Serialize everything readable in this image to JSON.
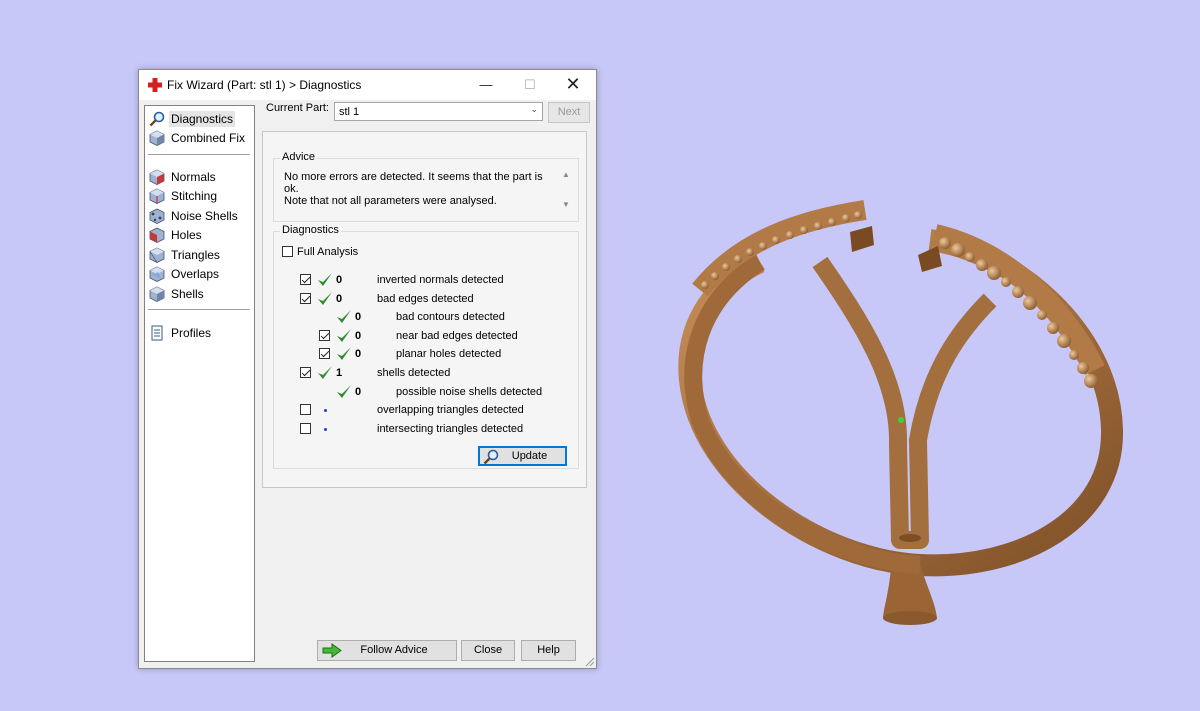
{
  "window": {
    "title": "Fix Wizard (Part: stl 1) > Diagnostics",
    "minimize_glyph": "—",
    "maximize_glyph": "☐",
    "close_glyph": "✕"
  },
  "nav": {
    "items": [
      {
        "label": "Diagnostics",
        "icon": "magnifier-icon",
        "selected": true
      },
      {
        "label": "Combined Fix",
        "icon": "cube-icon"
      },
      {
        "label": "Normals",
        "icon": "cube-normals-icon"
      },
      {
        "label": "Stitching",
        "icon": "cube-stitching-icon"
      },
      {
        "label": "Noise Shells",
        "icon": "cube-noise-icon"
      },
      {
        "label": "Holes",
        "icon": "cube-holes-icon"
      },
      {
        "label": "Triangles",
        "icon": "cube-triangles-icon"
      },
      {
        "label": "Overlaps",
        "icon": "cube-overlaps-icon"
      },
      {
        "label": "Shells",
        "icon": "cube-shells-icon"
      },
      {
        "label": "Profiles",
        "icon": "document-icon"
      }
    ]
  },
  "current_part": {
    "label": "Current Part:",
    "value": "stl 1",
    "next_label": "Next"
  },
  "advice": {
    "title": "Advice",
    "text": "No more errors are detected. It seems that the part is ok.\nNote that not all parameters were analysed."
  },
  "diagnostics": {
    "title": "Diagnostics",
    "full_analysis_label": "Full Analysis",
    "rows": [
      {
        "checkbox": true,
        "checked": true,
        "status": "ok",
        "count": "0",
        "label": "inverted normals detected",
        "indent": 0
      },
      {
        "checkbox": true,
        "checked": true,
        "status": "ok",
        "count": "0",
        "label": "bad edges detected",
        "indent": 0
      },
      {
        "checkbox": false,
        "checked": false,
        "status": "ok",
        "count": "0",
        "label": "bad contours detected",
        "indent": 1
      },
      {
        "checkbox": true,
        "checked": true,
        "status": "ok",
        "count": "0",
        "label": "near bad edges detected",
        "indent": 1
      },
      {
        "checkbox": true,
        "checked": true,
        "status": "ok",
        "count": "0",
        "label": "planar holes detected",
        "indent": 1
      },
      {
        "checkbox": true,
        "checked": true,
        "status": "ok",
        "count": "1",
        "label": "shells detected",
        "indent": 0
      },
      {
        "checkbox": false,
        "checked": false,
        "status": "ok",
        "count": "0",
        "label": "possible noise shells detected",
        "indent": 1
      },
      {
        "checkbox": true,
        "checked": false,
        "status": "none",
        "count": "",
        "label": "overlapping triangles detected",
        "indent": 0
      },
      {
        "checkbox": true,
        "checked": false,
        "status": "none",
        "count": "",
        "label": "intersecting triangles detected",
        "indent": 0
      }
    ],
    "update_label": "Update"
  },
  "buttons": {
    "follow_advice": "Follow Advice",
    "close": "Close",
    "help": "Help"
  },
  "colors": {
    "background": "#c8c8f8",
    "model": "#b07a48",
    "check_green": "#2e8b2e",
    "accent": "#0078d7"
  }
}
